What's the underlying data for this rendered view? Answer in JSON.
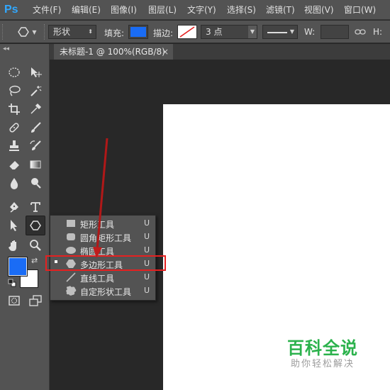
{
  "menubar": {
    "logo": "Ps",
    "items": [
      "文件(F)",
      "编辑(E)",
      "图像(I)",
      "图层(L)",
      "文字(Y)",
      "选择(S)",
      "滤镜(T)",
      "视图(V)",
      "窗口(W)"
    ]
  },
  "options": {
    "mode": "形状",
    "fill_label": "填充:",
    "stroke_label": "描边:",
    "stroke_width": "3 点",
    "w_label": "W:",
    "h_label": "H:",
    "fill_color": "#1a6cf5"
  },
  "document": {
    "tab_title": "未标题-1 @ 100%(RGB/8)",
    "tab_close": "×"
  },
  "toolbar": {
    "collapse": "◂◂",
    "foreground_color": "#1a6cf5",
    "background_color": "#ffffff"
  },
  "flyout": {
    "items": [
      {
        "label": "矩形工具",
        "key": "U",
        "icon": "rectangle-icon",
        "selected": false
      },
      {
        "label": "圆角矩形工具",
        "key": "U",
        "icon": "rounded-rectangle-icon",
        "selected": false
      },
      {
        "label": "椭圆工具",
        "key": "U",
        "icon": "ellipse-icon",
        "selected": false
      },
      {
        "label": "多边形工具",
        "key": "U",
        "icon": "polygon-icon",
        "selected": true
      },
      {
        "label": "直线工具",
        "key": "U",
        "icon": "line-icon",
        "selected": false
      },
      {
        "label": "自定形状工具",
        "key": "U",
        "icon": "custom-shape-icon",
        "selected": false
      }
    ]
  },
  "watermark": {
    "title": "百科全说",
    "subtitle": "助你轻松解决"
  },
  "annotation": {
    "color": "#e52020"
  }
}
